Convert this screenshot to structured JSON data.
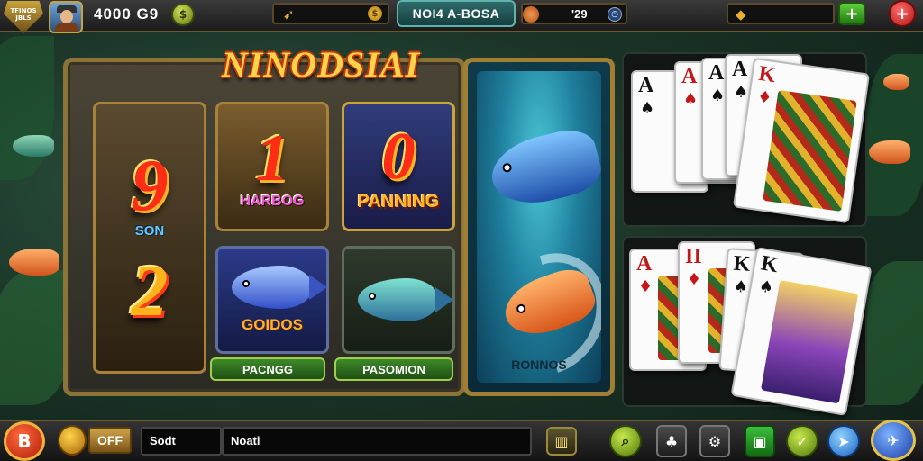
{
  "header": {
    "badge_text": "TFINOS\nJBLS",
    "score": "4000 G9",
    "coin_symbol": "$",
    "title": "NOI4 A-BOSA",
    "value": "'29",
    "plus_label": "+",
    "close_label": "+"
  },
  "machine": {
    "title": "NINODSIAI",
    "tile_1": {
      "digit_top": "9",
      "label": "SON",
      "digit_bottom": "2"
    },
    "tile_2": {
      "digit": "1",
      "label": "HARBOG"
    },
    "tile_3": {
      "digit": "0",
      "label": "PANNING"
    },
    "tile_4": {
      "label": "GOIDOS"
    },
    "buttons": [
      "PACNGG",
      "PASOMION"
    ]
  },
  "fish_panel": {
    "caption": "RONNOS"
  },
  "cards_top": [
    {
      "rank": "A",
      "suit": "♠",
      "color": "black"
    },
    {
      "rank": "A",
      "suit": "♠",
      "color": "red"
    },
    {
      "rank": "A",
      "suit": "♠",
      "color": "black"
    },
    {
      "rank": "A",
      "suit": "♠",
      "color": "black"
    },
    {
      "rank": "K",
      "suit": "♦",
      "color": "red"
    }
  ],
  "cards_bottom": [
    {
      "rank": "A",
      "suit": "♦",
      "color": "red"
    },
    {
      "rank": "II",
      "suit": "♦",
      "color": "red"
    },
    {
      "rank": "K",
      "suit": "♠",
      "color": "black"
    },
    {
      "rank": "K",
      "suit": "♠",
      "color": "black"
    }
  ],
  "footer": {
    "left_symbol": "B",
    "off_label": "OFF",
    "field_1": "Sodt",
    "field_2": "Noati",
    "icons": [
      "bar-chart-icon",
      "search-icon",
      "gift-icon",
      "gear-icon",
      "play-icon",
      "check-icon",
      "send-icon",
      "plane-icon"
    ]
  },
  "colors": {
    "accent_gold": "#c9a33c",
    "title_red_outline": "#c8360c",
    "button_green": "#3d8a2a"
  }
}
